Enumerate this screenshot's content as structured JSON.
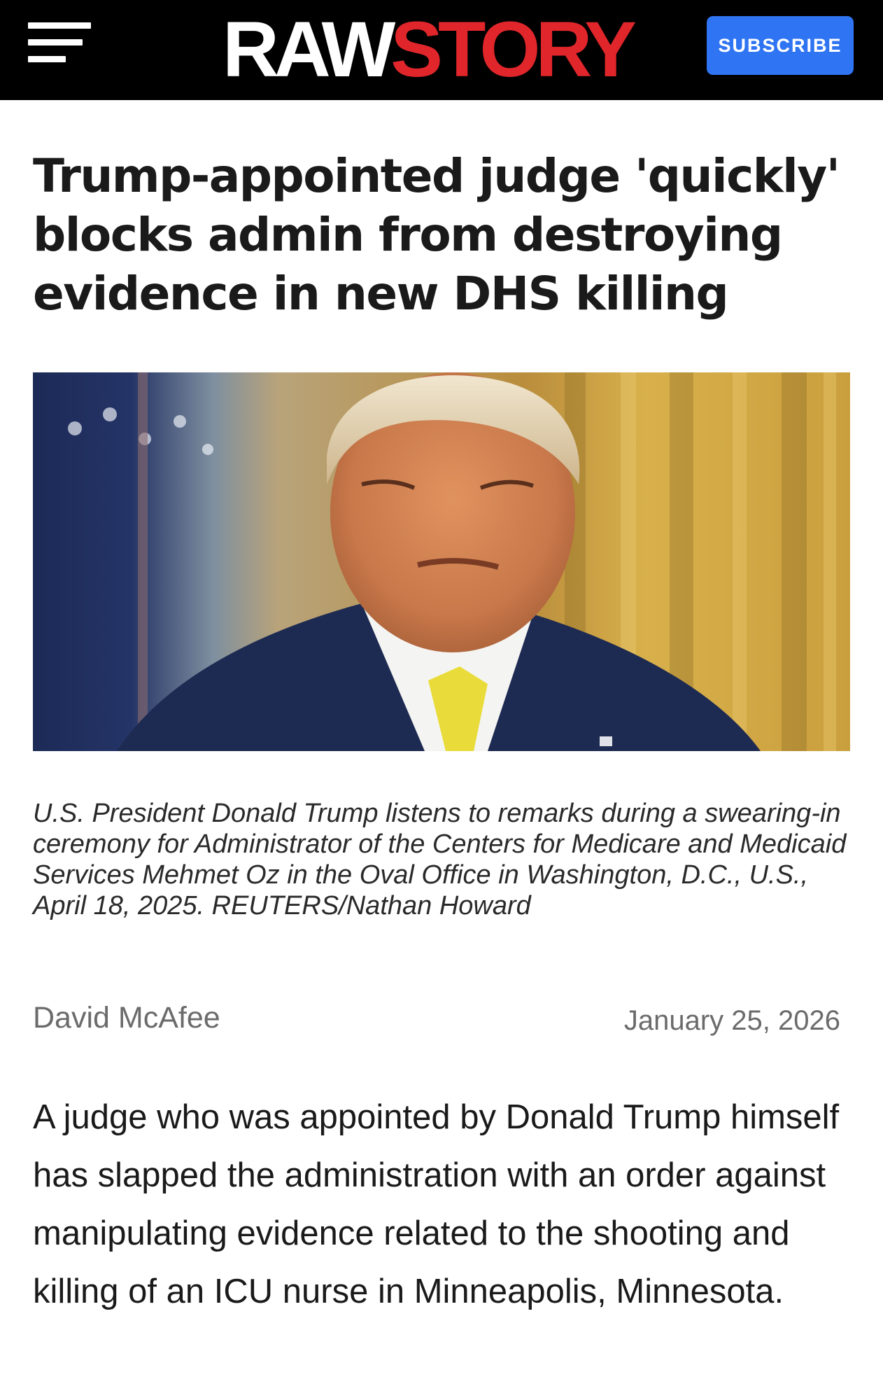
{
  "header": {
    "menu_icon": "hamburger-menu-icon",
    "logo": {
      "part1": "RAW",
      "part2": "STORY"
    },
    "subscribe_label": "SUBSCRIBE",
    "colors": {
      "background": "#000000",
      "logo_accent": "#e0262b",
      "subscribe_bg": "#2f74f2"
    }
  },
  "article": {
    "headline": "Trump-appointed judge 'quickly' blocks admin from destroying evidence in new DHS killing",
    "caption": "U.S. President Donald Trump listens to remarks during a swearing-in ceremony for Administrator of the Centers for Medicare and Medicaid Services Mehmet Oz in the Oval Office in Washington, D.C., U.S., April 18, 2025. REUTERS/Nathan Howard",
    "author": "David McAfee",
    "date": "January 25, 2026",
    "body": "A judge who was appointed by Donald Trump himself has slapped the administration with an order against manipulating evidence related to the shooting and killing of an ICU nurse in Minneapolis, Minnesota."
  }
}
